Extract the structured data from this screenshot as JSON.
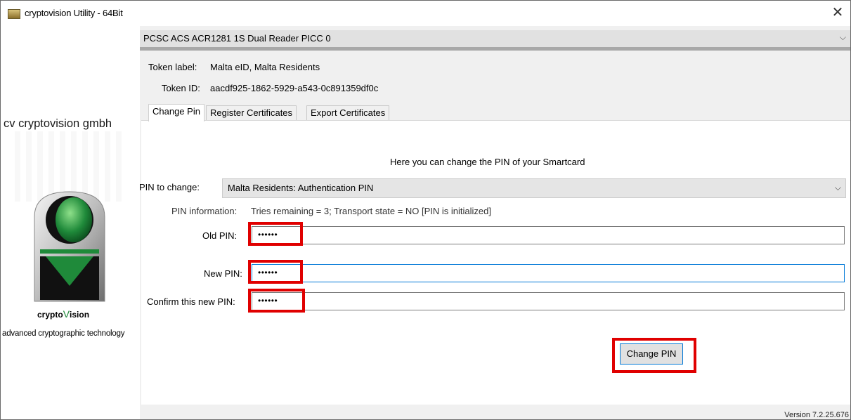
{
  "window": {
    "title": "cryptovision Utility - 64Bit",
    "close_glyph": "✕"
  },
  "sidebar": {
    "company": "cv cryptovision gmbh",
    "brand_prefix": "crypto",
    "brand_mark": "V",
    "brand_suffix": "ision",
    "tagline": "advanced cryptographic technology"
  },
  "reader": {
    "selected": "PCSC ACS ACR1281 1S Dual Reader PICC 0",
    "chevron": "⌵"
  },
  "token": {
    "label_caption": "Token label:",
    "label_value": "Malta eID, Malta Residents",
    "id_caption": "Token ID:",
    "id_value": "aacdf925-1862-5929-a543-0c891359df0c"
  },
  "tabs": [
    {
      "label": "Change Pin",
      "active": true
    },
    {
      "label": "Register Certificates",
      "active": false
    },
    {
      "label": "Export Certificates",
      "active": false
    }
  ],
  "change_pin": {
    "heading": "Here you can change the PIN of your Smartcard",
    "pin_to_change_label": "PIN to change:",
    "pin_to_change_value": "Malta Residents: Authentication PIN",
    "pin_info_label": "PIN information:",
    "pin_info_value": "Tries remaining = 3; Transport state = NO [PIN is initialized]",
    "old_pin_label": "Old PIN:",
    "old_pin_value": "••••••",
    "new_pin_label": "New PIN:",
    "new_pin_value": "••••••",
    "confirm_pin_label": "Confirm this new PIN:",
    "confirm_pin_value": "••••••",
    "button_label": "Change PIN"
  },
  "footer": {
    "version": "Version 7.2.25.676"
  },
  "colors": {
    "highlight": "#e00000",
    "focus": "#0078d7",
    "logo_green": "#1f8a3a"
  }
}
